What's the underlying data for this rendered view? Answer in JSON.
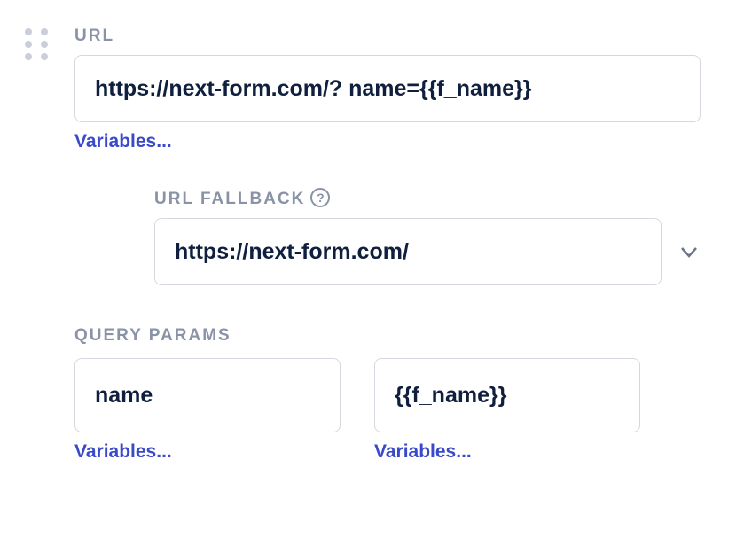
{
  "url": {
    "label": "URL",
    "value": "https://next-form.com/? name={{f_name}}",
    "variables_link": "Variables..."
  },
  "url_fallback": {
    "label": "URL FALLBACK",
    "value": "https://next-form.com/"
  },
  "query_params": {
    "label": "QUERY PARAMS",
    "key": {
      "value": "name",
      "variables_link": "Variables..."
    },
    "val": {
      "value": "{{f_name}}",
      "variables_link": "Variables..."
    }
  }
}
